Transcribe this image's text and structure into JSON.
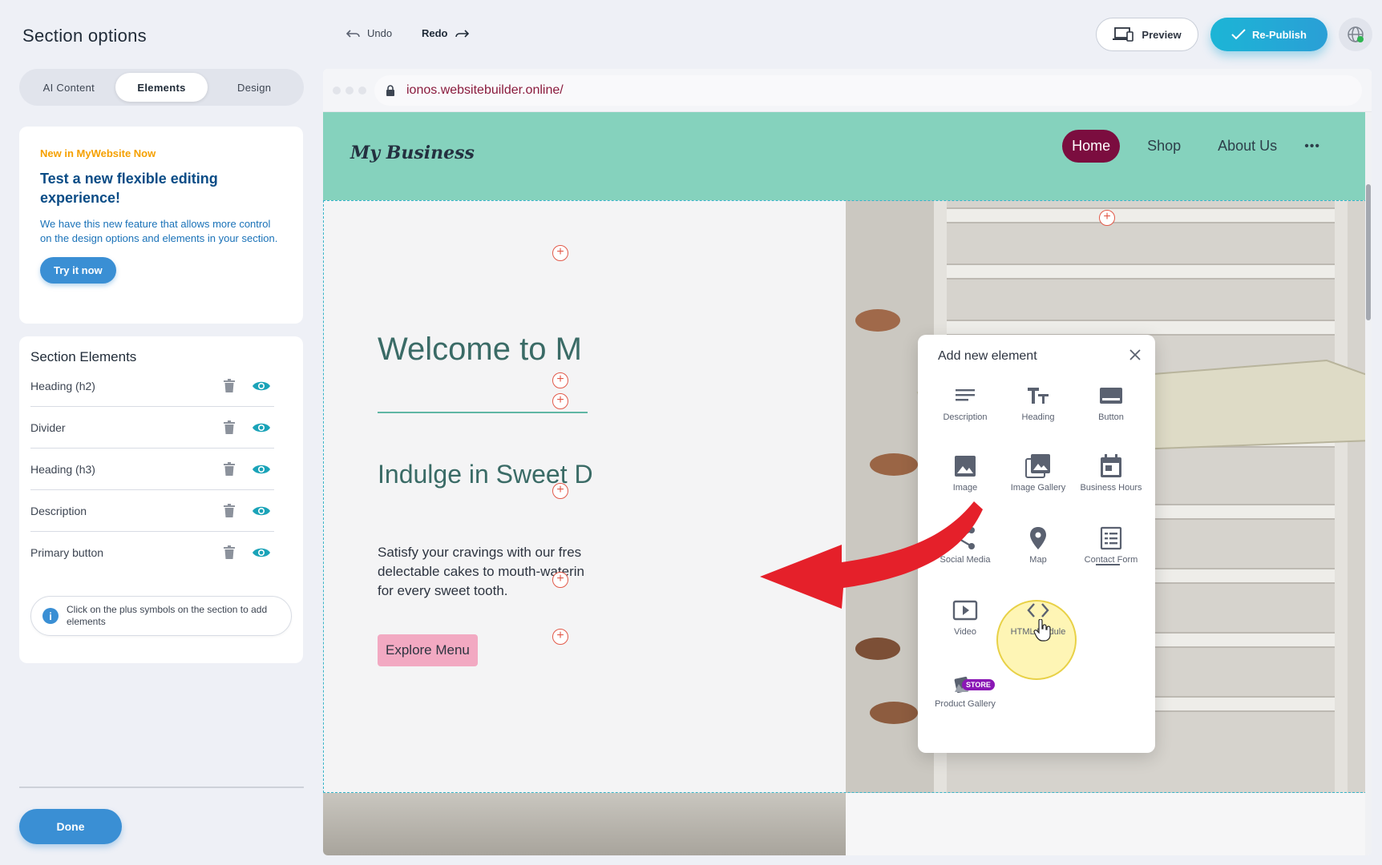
{
  "left_panel": {
    "title": "Section options",
    "tabs": [
      {
        "label": "AI Content"
      },
      {
        "label": "Elements"
      },
      {
        "label": "Design"
      }
    ],
    "promo": {
      "kicker": "New in MyWebsite Now",
      "title": "Test a new flexible editing experience!",
      "description": "We have this new feature that allows more control on the design options and elements in your section.",
      "button": "Try it now"
    },
    "section_elements": {
      "title": "Section Elements",
      "items": [
        {
          "label": "Heading (h2)"
        },
        {
          "label": "Divider"
        },
        {
          "label": "Heading (h3)"
        },
        {
          "label": "Description"
        },
        {
          "label": "Primary button"
        }
      ],
      "hint": "Click on the plus symbols on the section to add elements",
      "hint_icon": "i"
    },
    "done_button": "Done"
  },
  "toolbar": {
    "undo": "Undo",
    "redo": "Redo",
    "preview": "Preview",
    "republish": "Re-Publish"
  },
  "browser": {
    "url": "ionos.websitebuilder.online/"
  },
  "site": {
    "brand": "My Business",
    "nav": [
      {
        "label": "Home"
      },
      {
        "label": "Shop"
      },
      {
        "label": "About Us"
      }
    ],
    "nav_more": "•••",
    "hero": {
      "heading": "Welcome to M",
      "subheading": "Indulge in Sweet D",
      "paragraph_lines": [
        "Satisfy your cravings with our fres",
        "delectable cakes to mouth-waterin",
        "for every sweet tooth."
      ],
      "button": "Explore Menu"
    },
    "plus_symbol": "+"
  },
  "popup": {
    "title": "Add new element",
    "store_badge": "STORE",
    "items": [
      {
        "label": "Description",
        "icon": "description-icon"
      },
      {
        "label": "Heading",
        "icon": "heading-icon"
      },
      {
        "label": "Button",
        "icon": "button-icon"
      },
      {
        "label": "Image",
        "icon": "image-icon"
      },
      {
        "label": "Image Gallery",
        "icon": "image-gallery-icon"
      },
      {
        "label": "Business Hours",
        "icon": "business-hours-icon"
      },
      {
        "label": "Social Media",
        "icon": "share-icon"
      },
      {
        "label": "Map",
        "icon": "map-pin-icon"
      },
      {
        "label": "Contact Form",
        "icon": "contact-form-icon"
      },
      {
        "label": "Video",
        "icon": "video-icon"
      },
      {
        "label": "HTML Module",
        "icon": "code-icon"
      },
      {
        "label": "Product Gallery",
        "icon": "product-gallery-icon"
      }
    ]
  },
  "colors": {
    "accent_blue": "#3a8fd4",
    "publish_teal": "#1cb5d6",
    "header_mint": "#85d2bd",
    "nav_active": "#7b0d3f",
    "explore_pink": "#f2a9c2",
    "arrow_red": "#e5202a",
    "highlight_yellow": "#fdec78"
  }
}
